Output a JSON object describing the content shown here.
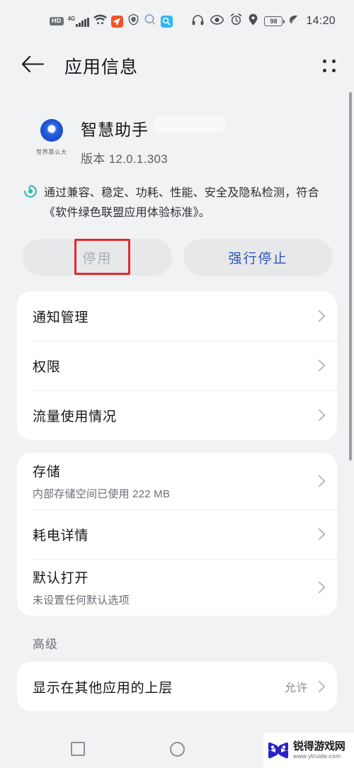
{
  "status_bar": {
    "hd_label": "HD",
    "network_label": "4G",
    "signal_icon": "signal-bars-icon",
    "wifi_icon": "wifi-icon",
    "nav_icon": "navigation-arrow-icon",
    "shield_icon": "shield-icon",
    "search_bubble_icon": "search-bubble-icon",
    "search_icon": "search-icon",
    "headphones_icon": "headphones-icon",
    "eye_icon": "eye-comfort-icon",
    "alarm_icon": "alarm-clock-icon",
    "location_icon": "location-pin-icon",
    "battery_percent": "98",
    "power_saving_icon": "leaf-power-saving-icon",
    "time": "14:20",
    "accent_orange": "#f4502a",
    "accent_blue": "#31b6f0"
  },
  "app_bar": {
    "back_icon": "back-arrow-icon",
    "title": "应用信息",
    "menu_icon": "four-dots-menu-icon"
  },
  "app_header": {
    "app_icon": "smart-assistant-app-icon",
    "icon_watermark": "世界那么大",
    "app_name": "智慧助手",
    "version_label": "版本 12.0.1.303"
  },
  "certification": {
    "icon": "green-alliance-cert-icon",
    "text": "通过兼容、稳定、功耗、性能、安全及隐私检测，符合《软件绿色联盟应用体验标准》。",
    "icon_color": "#2fbfae"
  },
  "actions": {
    "disable_label": "停用",
    "force_stop_label": "强行停止",
    "annotation_color": "#e02a2a",
    "primary_color": "#2f56b8"
  },
  "cards": [
    {
      "rows": [
        {
          "title": "通知管理",
          "sub": "",
          "value": ""
        },
        {
          "title": "权限",
          "sub": "",
          "value": ""
        },
        {
          "title": "流量使用情况",
          "sub": "",
          "value": ""
        }
      ]
    },
    {
      "rows": [
        {
          "title": "存储",
          "sub": "内部存储空间已使用 222 MB",
          "value": ""
        },
        {
          "title": "耗电详情",
          "sub": "",
          "value": ""
        },
        {
          "title": "默认打开",
          "sub": "未设置任何默认选项",
          "value": ""
        }
      ]
    }
  ],
  "advanced": {
    "section_label": "高级",
    "rows": [
      {
        "title": "显示在其他应用的上层",
        "sub": "",
        "value": "允许"
      }
    ]
  },
  "nav_bar": {
    "recents_icon": "recents-square-icon",
    "home_icon": "home-circle-icon",
    "back_icon": "back-triangle-icon"
  },
  "watermark": {
    "logo_icon": "bowtie-logo-icon",
    "name": "锐得游戏网",
    "url": "www.ytruide.com",
    "logo_color": "#2b21c9"
  }
}
